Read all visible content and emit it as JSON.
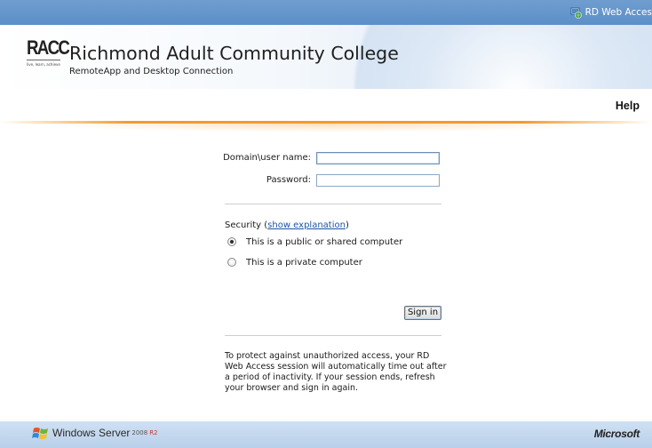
{
  "topbar": {
    "rd_label": "RD Web Acces"
  },
  "header": {
    "logo_mark": "RACC",
    "logo_tagline": "live, learn, achieve",
    "college_name": "Richmond Adult Community College",
    "subtitle": "RemoteApp and Desktop Connection"
  },
  "nav": {
    "help_label": "Help"
  },
  "form": {
    "username_label": "Domain\\user name:",
    "username_value": "",
    "password_label": "Password:",
    "password_value": "",
    "security_label": "Security (",
    "security_link": "show explanation",
    "security_close": ")",
    "options": [
      {
        "label": "This is a public or shared computer",
        "checked": true
      },
      {
        "label": "This is a private computer",
        "checked": false
      }
    ],
    "signin_label": "Sign in",
    "notice": "To protect against unauthorized access, your RD Web Access session will automatically time out after a period of inactivity. If your session ends, refresh your browser and sign in again."
  },
  "footer": {
    "windows_name": "Windows Server",
    "windows_version": "2008",
    "windows_edition": "R2",
    "microsoft": "Microsoft"
  },
  "colors": {
    "topbar": "#5b8fc8",
    "accent_orange": "#f39a2c",
    "link": "#1c55a6",
    "footer": "#b9d0ea"
  }
}
